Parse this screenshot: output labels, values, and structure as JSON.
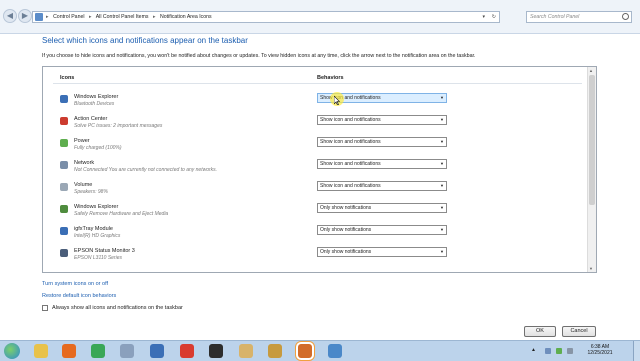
{
  "address": {
    "crumbs": [
      "Control Panel",
      "All Control Panel Items",
      "Notification Area Icons"
    ],
    "search_placeholder": "Search Control Panel"
  },
  "page": {
    "title": "Select which icons and notifications appear on the taskbar",
    "description": "If you choose to hide icons and notifications, you won't be notified about changes or updates. To view hidden icons at any time, click the arrow next to the notification area on the taskbar."
  },
  "table": {
    "col_icons": "Icons",
    "col_behaviors": "Behaviors",
    "rows": [
      {
        "name": "Windows Explorer",
        "sub": "Bluetooth Devices",
        "behavior": "Show icon and notifications",
        "icon": "bluetooth-icon",
        "color": "#3b6fb6"
      },
      {
        "name": "Action Center",
        "sub": "Solve PC issues: 2 important messages",
        "behavior": "Show icon and notifications",
        "icon": "flag-icon",
        "color": "#cc3b2f"
      },
      {
        "name": "Power",
        "sub": "Fully charged (100%)",
        "behavior": "Show icon and notifications",
        "icon": "battery-icon",
        "color": "#5fae4f"
      },
      {
        "name": "Network",
        "sub": "Not Connected You are currently not connected to any networks.",
        "behavior": "Show icon and notifications",
        "icon": "network-icon",
        "color": "#7a8ea8"
      },
      {
        "name": "Volume",
        "sub": "Speakers: 98%",
        "behavior": "Show icon and notifications",
        "icon": "speaker-icon",
        "color": "#9aa7b5"
      },
      {
        "name": "Windows Explorer",
        "sub": "Safely Remove Hardware and Eject Media",
        "behavior": "Only show notifications",
        "icon": "usb-icon",
        "color": "#4f8c3e"
      },
      {
        "name": "igfxTray Module",
        "sub": "Intel(R) HD Graphics",
        "behavior": "Only show notifications",
        "icon": "monitor-icon",
        "color": "#3a6eb5"
      },
      {
        "name": "EPSON Status Monitor 3",
        "sub": "EPSON L3110 Series",
        "behavior": "Only show notifications",
        "icon": "printer-icon",
        "color": "#4b5e7a"
      }
    ]
  },
  "links": {
    "turn_system_icons": "Turn system icons on or off",
    "restore_defaults": "Restore default icon behaviors",
    "always_show": "Always show all icons and notifications on the taskbar"
  },
  "buttons": {
    "ok": "OK",
    "cancel": "Cancel"
  },
  "taskbar": {
    "time": "6:38 AM",
    "date": "12/25/2021",
    "apps": [
      {
        "icon": "folder-icon",
        "color": "#e8c24a"
      },
      {
        "icon": "firefox-icon",
        "color": "#e66a1f"
      },
      {
        "icon": "chrome-icon",
        "color": "#3aa757"
      },
      {
        "icon": "tools-icon",
        "color": "#8aa0bd"
      },
      {
        "icon": "security-icon",
        "color": "#3b6fb6"
      },
      {
        "icon": "calendar-app-icon",
        "color": "#d93b2f"
      },
      {
        "icon": "media-player-icon",
        "color": "#2d2d2d"
      },
      {
        "icon": "gallery-icon",
        "color": "#d8b36a"
      },
      {
        "icon": "files-icon",
        "color": "#c79a3e"
      },
      {
        "icon": "settings-app-icon",
        "color": "#d26c2a"
      },
      {
        "icon": "display-app-icon",
        "color": "#4a88c9"
      }
    ]
  }
}
